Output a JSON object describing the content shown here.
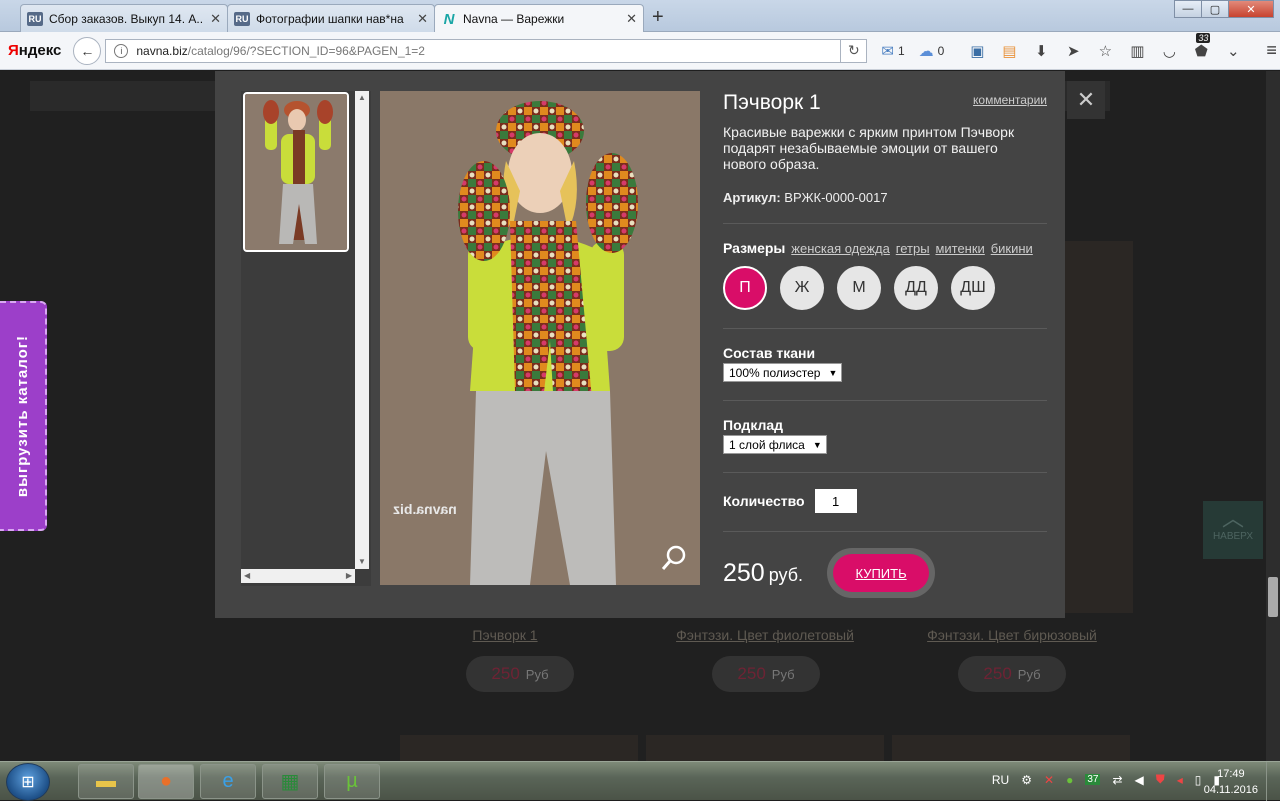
{
  "browser": {
    "tabs": [
      {
        "favicon": "RU",
        "title": "Сбор заказов. Выкуп 14. А..."
      },
      {
        "favicon": "RU",
        "title": "Фотографии шапки нав*на"
      },
      {
        "favicon": "N",
        "title": "Navna — Варежки"
      }
    ],
    "new_tab": "+",
    "window_buttons": {
      "minimize": "—",
      "maximize": "▢",
      "close": "✕"
    },
    "logo_ya": "Я",
    "logo_rest": "ндекс",
    "url_host": "navna.biz",
    "url_path": "/catalog/96/?SECTION_ID=96&PAGEN_1=2",
    "mail_count": "1",
    "weather_temp": "0",
    "notif_count": "33"
  },
  "page": {
    "side_tab": "выгрузить каталог!",
    "to_top": "НАВЕРХ",
    "products": [
      {
        "name": "Пэчворк 1",
        "price": "250",
        "currency": "Руб"
      },
      {
        "name": "Фэнтэзи. Цвет фиолетовый",
        "price": "250",
        "currency": "Руб"
      },
      {
        "name": "Фэнтэзи. Цвет бирюзовый",
        "price": "250",
        "currency": "Руб"
      }
    ]
  },
  "modal": {
    "title": "Пэчворк 1",
    "comments": "комментарии",
    "description": "Красивые варежки с ярким принтом Пэчворк подарят незабываемые эмоции от вашего нового образа.",
    "article_label": "Артикул:",
    "article_value": "ВРЖК-0000-0017",
    "sizes_label": "Размеры",
    "size_links": [
      "женская одежда",
      "гетры",
      "митенки",
      "бикини"
    ],
    "sizes": [
      "П",
      "Ж",
      "М",
      "ДД",
      "ДШ"
    ],
    "selected_size": "П",
    "fabric_label": "Состав ткани",
    "fabric_value": "100% полиэстер",
    "lining_label": "Подклад",
    "lining_value": "1 слой флиса",
    "qty_label": "Количество",
    "qty_value": "1",
    "price": "250",
    "price_currency": "руб.",
    "buy_label": "КУПИТЬ",
    "watermark": "navna.biz",
    "close": "✕"
  },
  "taskbar": {
    "lang": "RU",
    "tray_badge": "37",
    "time": "17:49",
    "date": "04.11.2016"
  },
  "colors": {
    "accent": "#d90d68",
    "side_tab": "#9c3fc9"
  }
}
